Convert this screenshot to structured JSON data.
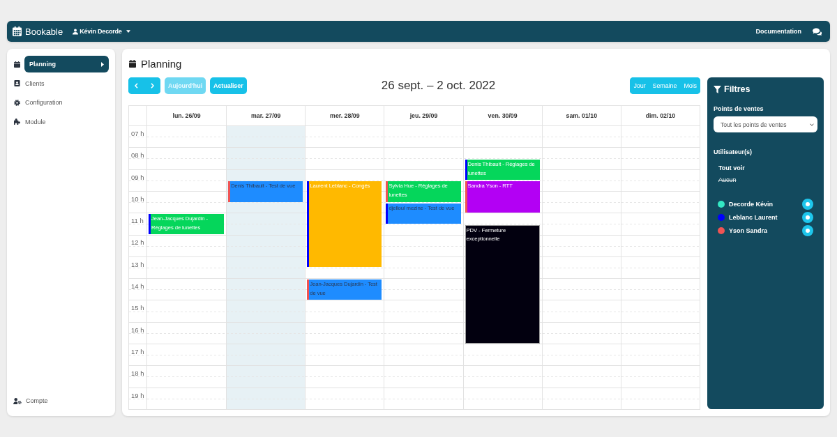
{
  "topbar": {
    "brand": "Bookable",
    "user": "Kévin Decorde",
    "links": [
      "Documentation"
    ]
  },
  "sidebar": {
    "items": [
      {
        "label": "Planning",
        "selected": true
      },
      {
        "label": "Clients",
        "selected": false
      },
      {
        "label": "Configuration",
        "selected": false
      },
      {
        "label": "Module",
        "selected": false
      }
    ],
    "footer_item": {
      "label": "Compte"
    }
  },
  "page": {
    "title": "Planning"
  },
  "toolbar": {
    "buttons": [
      {
        "label": "Aujourd'hui",
        "disabled": true
      },
      {
        "label": "Actualiser",
        "disabled": false
      }
    ],
    "range_title": "26 sept. – 2 oct. 2022",
    "views": [
      "Jour",
      "Semaine",
      "Mois"
    ]
  },
  "calendar": {
    "hours": [
      "07 h",
      "08 h",
      "09 h",
      "10 h",
      "11 h",
      "12 h",
      "13 h",
      "14 h",
      "15 h",
      "16 h",
      "17 h",
      "18 h",
      "19 h"
    ],
    "days": [
      {
        "label": "lun. 26/09",
        "today": false,
        "events": [
          {
            "title": "Jean-Jacques Dujardin - Réglages de lunettes",
            "kind": "appointment",
            "color": "#05d65b",
            "user": {
              "color": "#0000ff"
            },
            "dark_text": false
          }
        ]
      },
      {
        "label": "mar. 27/09",
        "today": true,
        "events": [
          {
            "title": "Denis Thibault - Test de vue",
            "kind": "appointment",
            "color": "#1e8cff",
            "user": {
              "color": "#f05454"
            },
            "dark_text": true
          }
        ]
      },
      {
        "label": "mer. 28/09",
        "today": false,
        "events": [
          {
            "title": "Laurent Leblanc - Congés",
            "kind": "appointment",
            "color": "#ffb900",
            "user": {
              "color": "#0000ff"
            },
            "dark_text": false
          },
          {
            "title": "Jean-Jacques Dujardin - Test de vue",
            "kind": "appointment",
            "color": "#1e8cff",
            "user": {
              "color": "#f05454"
            },
            "dark_text": true
          }
        ]
      },
      {
        "label": "jeu. 29/09",
        "today": false,
        "events": [
          {
            "title": "Sylvia Hue - Réglages de lunettes",
            "kind": "appointment",
            "color": "#05d65b",
            "user": {
              "color": "#f05454"
            },
            "dark_text": false
          },
          {
            "title": "djelloul mezine - Test de vue",
            "kind": "appointment",
            "color": "#1e8cff",
            "user": {
              "color": "#0000ff"
            },
            "dark_text": true
          }
        ]
      },
      {
        "label": "ven. 30/09",
        "today": false,
        "events": [
          {
            "title": "Denis Thibault - Réglages de lunettes",
            "kind": "appointment",
            "color": "#05d65b",
            "user": {
              "color": "#0000ff"
            },
            "dark_text": false
          },
          {
            "title": "Sandra Yson - RTT",
            "kind": "appointment",
            "color": "#b300f4",
            "user": {
              "color": "#f05454"
            },
            "dark_text": false
          },
          {
            "title": "PDV - Fermeture exceptionnelle",
            "kind": "closure",
            "color": "#02000f",
            "dark_text": false
          }
        ]
      },
      {
        "label": "sam. 01/10",
        "today": false
      },
      {
        "label": "dim. 02/10",
        "today": false
      }
    ]
  },
  "filters": {
    "title": "Filtres",
    "sales_points": {
      "label": "Points de ventes",
      "value": "Tout les points de ventes"
    },
    "users": {
      "label": "Utilisateur(s)",
      "actions": [
        {
          "label": "Tout voir",
          "disabled": false
        },
        {
          "label": "Aucun",
          "disabled": true
        }
      ],
      "items": [
        {
          "name": "Decorde Kévin",
          "color": "#34e8c4",
          "visible": true
        },
        {
          "name": "Leblanc Laurent",
          "color": "#0000ff",
          "visible": true
        },
        {
          "name": "Yson Sandra",
          "color": "#f05454",
          "visible": true
        }
      ]
    }
  }
}
